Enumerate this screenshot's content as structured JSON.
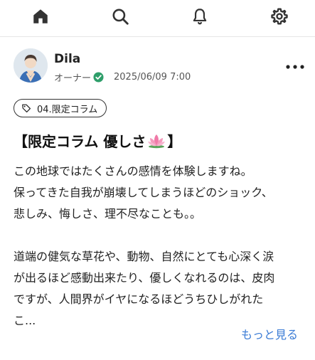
{
  "nav": {
    "home_icon": "home-icon",
    "search_icon": "search-icon",
    "bell_icon": "bell-icon",
    "settings_icon": "gear-icon"
  },
  "post": {
    "author": "Dila",
    "role": "オーナー",
    "date": "2025/06/09 7:00",
    "tag": "04.限定コラム",
    "title_prefix": "【限定コラム 優しさ",
    "title_suffix": "】",
    "body": [
      "この地球ではたくさんの感情を体験しますね。",
      "保ってきた自我が崩壊してしまうほどのショック、",
      "悲しみ、悔しさ、理不尽なことも。。",
      "",
      "道端の健気な草花や、動物、自然にとても心深く涙",
      "が出るほど感動出来たり、優しくなれるのは、皮肉",
      "ですが、人間界がイヤになるほどうちひしがれた",
      "こ..."
    ],
    "read_more": "もっと見る"
  },
  "colors": {
    "accent": "#3a7bd5",
    "verified": "#2e9e6a"
  }
}
